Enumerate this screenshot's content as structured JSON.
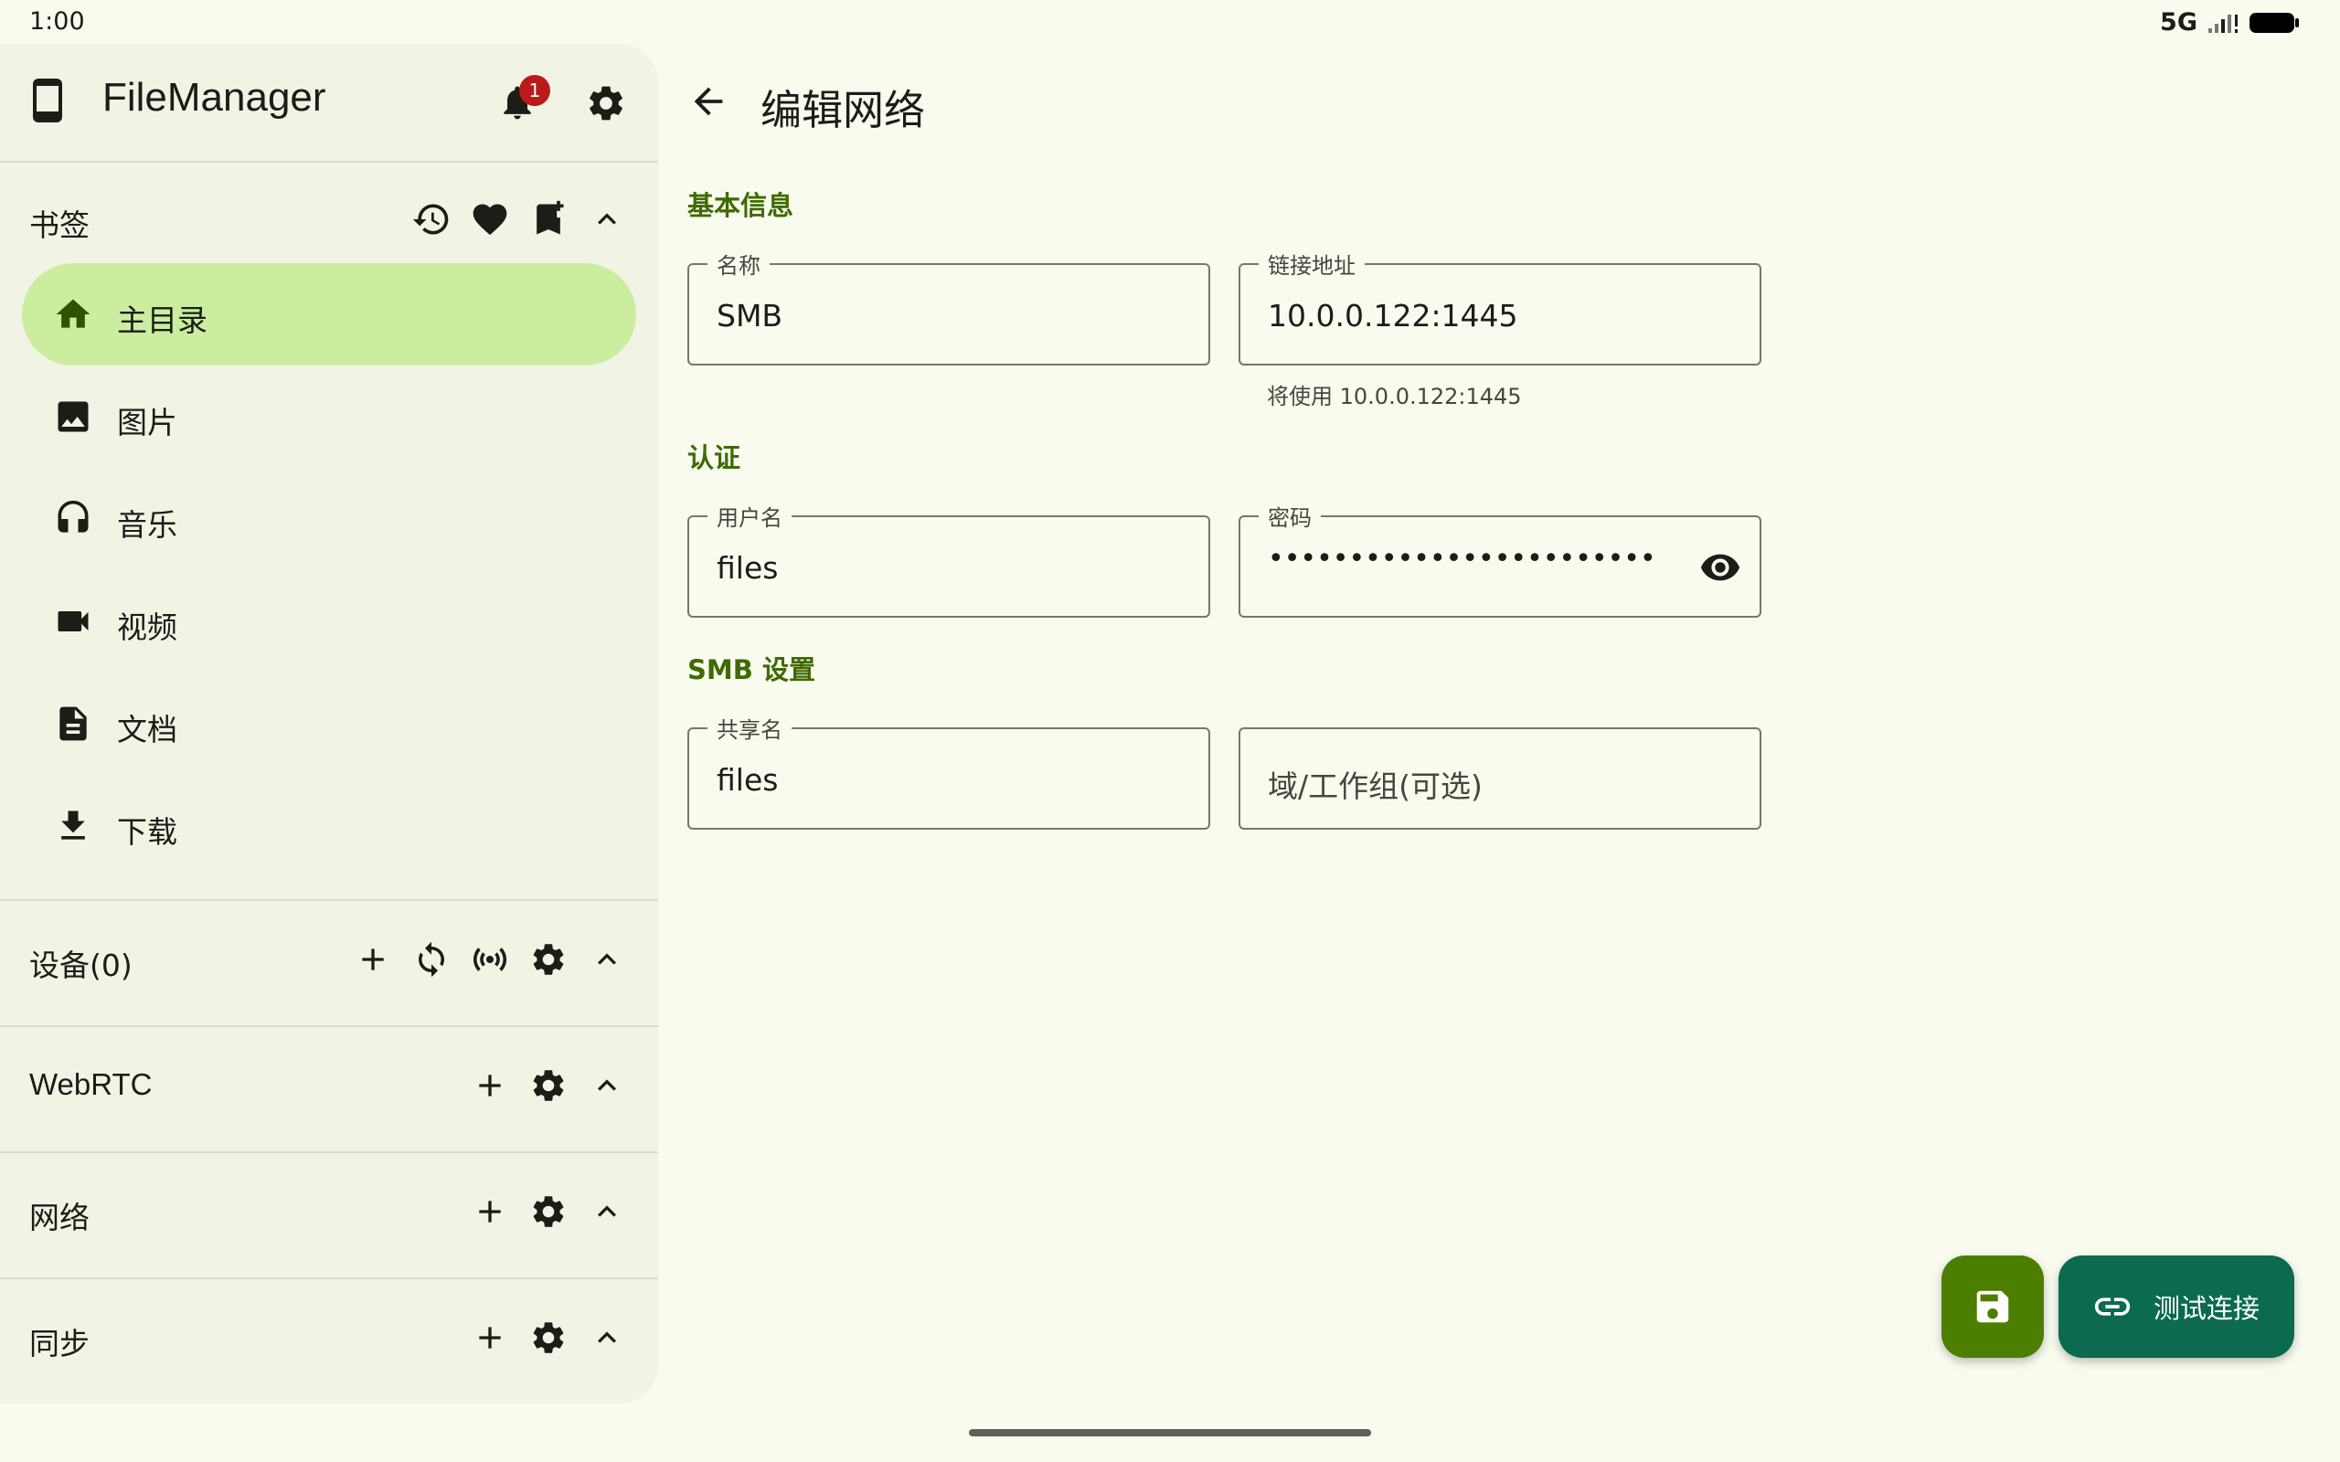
{
  "status_bar": {
    "time": "1:00",
    "network": "5G"
  },
  "drawer": {
    "app_title": "FileManager",
    "notification_count": "1",
    "bookmarks": {
      "title": "书签",
      "items": [
        {
          "label": "主目录",
          "icon": "home-icon",
          "active": true
        },
        {
          "label": "图片",
          "icon": "image-icon"
        },
        {
          "label": "音乐",
          "icon": "headphones-icon"
        },
        {
          "label": "视频",
          "icon": "video-icon"
        },
        {
          "label": "文档",
          "icon": "document-icon"
        },
        {
          "label": "下载",
          "icon": "download-icon"
        }
      ]
    },
    "sections": {
      "devices": "设备(0)",
      "webrtc": "WebRTC",
      "network": "网络",
      "sync": "同步"
    }
  },
  "main": {
    "title": "编辑网络",
    "basic_info": {
      "title": "基本信息",
      "name_label": "名称",
      "name_value": "SMB",
      "address_label": "链接地址",
      "address_value": "10.0.0.122:1445",
      "address_helper": "将使用 10.0.0.122:1445"
    },
    "auth": {
      "title": "认证",
      "username_label": "用户名",
      "username_value": "files",
      "password_label": "密码",
      "password_value": "••••••••••••••••••••••••"
    },
    "smb_settings": {
      "title": "SMB 设置",
      "share_label": "共享名",
      "share_value": "files",
      "domain_placeholder": "域/工作组(可选)"
    }
  },
  "fab": {
    "test_label": "测试连接"
  },
  "colors": {
    "background": "#f8fbee",
    "drawer": "#f1f4e4",
    "active_item": "#cbeda0",
    "accent": "#3e6a00",
    "save_fab": "#4c7e00",
    "test_fab": "#0b6a4f",
    "badge": "#ba1a1a"
  }
}
